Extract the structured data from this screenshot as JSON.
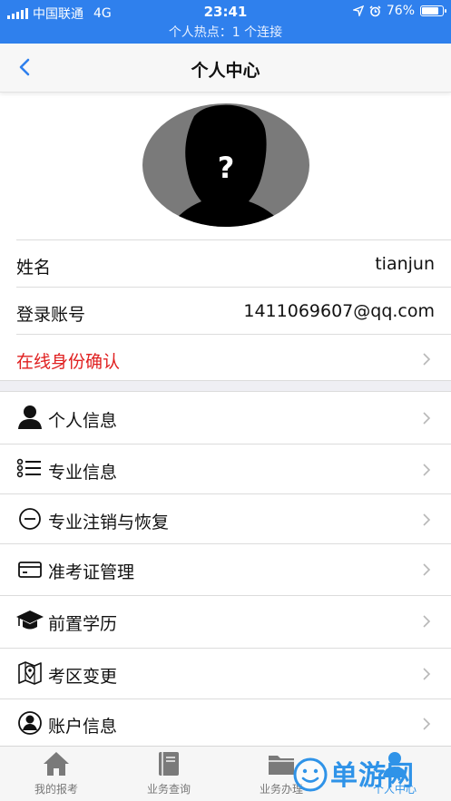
{
  "status_bar": {
    "carrier": "中国联通",
    "network": "4G",
    "time": "23:41",
    "battery": "76%",
    "battery_level": 0.76,
    "hotspot": "个人热点：1 个连接"
  },
  "nav": {
    "title": "个人中心"
  },
  "profile": {
    "name_label": "姓名",
    "name_value": "tianjun",
    "account_label": "登录账号",
    "account_value": "1411069607@qq.com",
    "verify_label": "在线身份确认"
  },
  "menu": [
    {
      "label": "个人信息",
      "icon": "person-icon"
    },
    {
      "label": "专业信息",
      "icon": "list-icon"
    },
    {
      "label": "专业注销与恢复",
      "icon": "minus-circle-icon"
    },
    {
      "label": "准考证管理",
      "icon": "card-icon"
    },
    {
      "label": "前置学历",
      "icon": "graduation-cap-icon"
    },
    {
      "label": "考区变更",
      "icon": "map-icon"
    },
    {
      "label": "账户信息",
      "icon": "account-icon"
    }
  ],
  "tabs": [
    {
      "label": "我的报考",
      "icon": "home-icon"
    },
    {
      "label": "业务查询",
      "icon": "book-icon"
    },
    {
      "label": "业务办理",
      "icon": "folder-icon"
    },
    {
      "label": "个人中心",
      "icon": "user-icon"
    }
  ],
  "colors": {
    "status_bar": "#2f80ed",
    "accent_red": "#e02020",
    "active_tab": "#2f93e8"
  }
}
